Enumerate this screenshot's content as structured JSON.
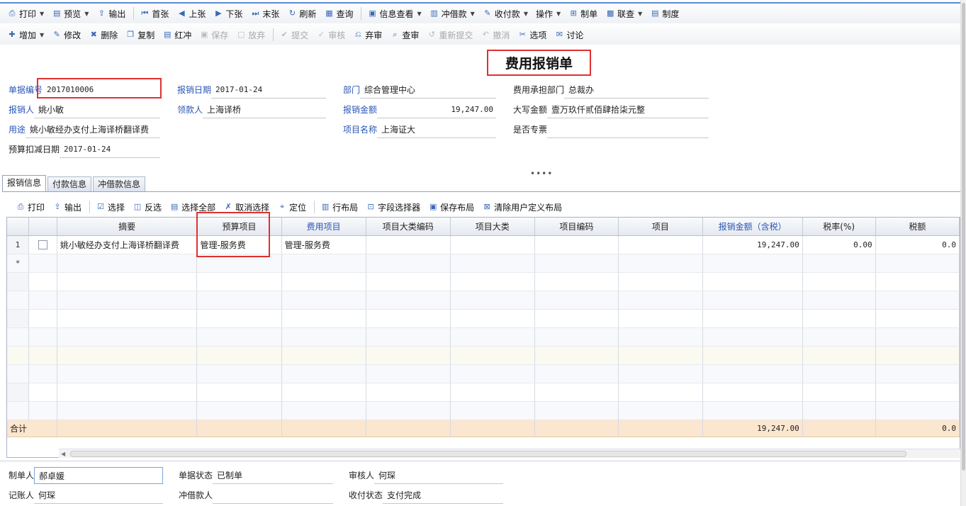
{
  "toolbar1": [
    {
      "label": "打印",
      "icon": "printer-icon",
      "glyph": "⎙",
      "dropdown": true
    },
    {
      "label": "预览",
      "icon": "preview-icon",
      "glyph": "▤",
      "dropdown": true
    },
    {
      "label": "输出",
      "icon": "export-icon",
      "glyph": "⇪"
    },
    {
      "sep": true
    },
    {
      "label": "首张",
      "icon": "first-icon",
      "glyph": "⏮"
    },
    {
      "label": "上张",
      "icon": "prev-icon",
      "glyph": "◀"
    },
    {
      "label": "下张",
      "icon": "next-icon",
      "glyph": "▶"
    },
    {
      "label": "末张",
      "icon": "last-icon",
      "glyph": "⏭"
    },
    {
      "label": "刷新",
      "icon": "refresh-icon",
      "glyph": "↻"
    },
    {
      "label": "查询",
      "icon": "query-icon",
      "glyph": "▦"
    },
    {
      "sep": true
    },
    {
      "label": "信息查看",
      "icon": "info-icon",
      "glyph": "▣",
      "dropdown": true
    },
    {
      "label": "冲借款",
      "icon": "offset-loan-icon",
      "glyph": "▥",
      "dropdown": true
    },
    {
      "label": "收付款",
      "icon": "payment-icon",
      "glyph": "✎",
      "dropdown": true
    },
    {
      "label": "操作",
      "icon": "",
      "glyph": "",
      "dropdown": true
    },
    {
      "label": "制单",
      "icon": "make-voucher-icon",
      "glyph": "⊞"
    },
    {
      "label": "联查",
      "icon": "link-query-icon",
      "glyph": "▩",
      "dropdown": true
    },
    {
      "label": "制度",
      "icon": "policy-icon",
      "glyph": "▤"
    }
  ],
  "toolbar2": [
    {
      "label": "增加",
      "icon": "add-icon",
      "glyph": "✚",
      "dropdown": true
    },
    {
      "label": "修改",
      "icon": "edit-icon",
      "glyph": "✎"
    },
    {
      "label": "删除",
      "icon": "delete-icon",
      "glyph": "✖"
    },
    {
      "label": "复制",
      "icon": "copy-icon",
      "glyph": "❐"
    },
    {
      "label": "红冲",
      "icon": "red-reverse-icon",
      "glyph": "▤"
    },
    {
      "label": "保存",
      "icon": "save-icon",
      "glyph": "▣",
      "disabled": true
    },
    {
      "label": "放弃",
      "icon": "discard-icon",
      "glyph": "▢",
      "disabled": true
    },
    {
      "sep": true
    },
    {
      "label": "提交",
      "icon": "submit-icon",
      "glyph": "✔",
      "disabled": true
    },
    {
      "label": "审核",
      "icon": "audit-icon",
      "glyph": "✓",
      "disabled": true
    },
    {
      "label": "弃审",
      "icon": "unaudit-icon",
      "glyph": "⎌"
    },
    {
      "label": "查审",
      "icon": "view-audit-icon",
      "glyph": "⌕"
    },
    {
      "label": "重新提交",
      "icon": "resubmit-icon",
      "glyph": "↺",
      "disabled": true
    },
    {
      "label": "撤消",
      "icon": "undo-icon",
      "glyph": "↶",
      "disabled": true
    },
    {
      "label": "选项",
      "icon": "options-icon",
      "glyph": "✂"
    },
    {
      "label": "讨论",
      "icon": "discuss-icon",
      "glyph": "✉"
    }
  ],
  "form": {
    "title": "费用报销单",
    "doc_no": {
      "label": "单据编号",
      "value": "2017010006"
    },
    "apply_date": {
      "label": "报销日期",
      "value": "2017-01-24"
    },
    "dept": {
      "label": "部门",
      "value": "综合管理中心"
    },
    "cost_dept": {
      "label": "费用承担部门",
      "value": "总裁办"
    },
    "reimburser": {
      "label": "报销人",
      "value": "姚小敏"
    },
    "payee": {
      "label": "领款人",
      "value": "上海译桥"
    },
    "amount": {
      "label": "报销金额",
      "value": "19,247.00"
    },
    "amount_caps": {
      "label": "大写金额",
      "value": "壹万玖仟贰佰肆拾柒元整"
    },
    "purpose": {
      "label": "用途",
      "value": "姚小敏经办支付上海译桥翻译费"
    },
    "project_name": {
      "label": "项目名称",
      "value": "上海证大"
    },
    "special_invoice": {
      "label": "是否专票",
      "value": ""
    },
    "budget_date": {
      "label": "预算扣减日期",
      "value": "2017-01-24"
    },
    "dots": "••••"
  },
  "tabs": [
    "报销信息",
    "付款信息",
    "冲借款信息"
  ],
  "grid_toolbar": [
    {
      "label": "打印",
      "icon": "printer-icon",
      "glyph": "⎙"
    },
    {
      "label": "输出",
      "icon": "export-icon",
      "glyph": "⇪"
    },
    {
      "sep": true
    },
    {
      "label": "选择",
      "icon": "select-icon",
      "glyph": "☑"
    },
    {
      "label": "反选",
      "icon": "invert-select-icon",
      "glyph": "◫"
    },
    {
      "label": "选择全部",
      "icon": "select-all-icon",
      "glyph": "▤"
    },
    {
      "label": "取消选择",
      "icon": "cancel-select-icon",
      "glyph": "✗"
    },
    {
      "label": "定位",
      "icon": "locate-icon",
      "glyph": "⌖"
    },
    {
      "sep": true
    },
    {
      "label": "行布局",
      "icon": "row-layout-icon",
      "glyph": "▥"
    },
    {
      "label": "字段选择器",
      "icon": "field-chooser-icon",
      "glyph": "⊡"
    },
    {
      "label": "保存布局",
      "icon": "save-layout-icon",
      "glyph": "▣"
    },
    {
      "label": "清除用户定义布局",
      "icon": "clear-layout-icon",
      "glyph": "⊠"
    }
  ],
  "grid": {
    "columns": [
      {
        "label": "",
        "blue": false
      },
      {
        "label": "",
        "blue": false
      },
      {
        "label": "摘要",
        "blue": false
      },
      {
        "label": "预算项目",
        "blue": false
      },
      {
        "label": "费用项目",
        "blue": true
      },
      {
        "label": "项目大类编码",
        "blue": false
      },
      {
        "label": "项目大类",
        "blue": false
      },
      {
        "label": "项目编码",
        "blue": false
      },
      {
        "label": "项目",
        "blue": false
      },
      {
        "label": "报销金额（含税）",
        "blue": true
      },
      {
        "label": "税率(%)",
        "blue": false
      },
      {
        "label": "税额",
        "blue": false
      }
    ],
    "row": {
      "index": "1",
      "summary": "姚小敏经办支付上海译桥翻译费",
      "budget_item": "管理-服务费",
      "expense_item": "管理-服务费",
      "project_class_code": "",
      "project_class": "",
      "project_code": "",
      "project": "",
      "amount": "19,247.00",
      "tax_rate": "0.00",
      "tax": "0.0"
    },
    "new_row_marker": "*",
    "total": {
      "label": "合计",
      "amount": "19,247.00",
      "tax": "0.0"
    }
  },
  "footer": {
    "maker": {
      "label": "制单人",
      "value": "郝卓媛"
    },
    "doc_status": {
      "label": "单据状态",
      "value": "已制单"
    },
    "auditor": {
      "label": "审核人",
      "value": "何琛"
    },
    "bookkeeper": {
      "label": "记账人",
      "value": "何琛"
    },
    "loan_offset": {
      "label": "冲借款人",
      "value": ""
    },
    "pay_status": {
      "label": "收付状态",
      "value": "支付完成"
    }
  }
}
